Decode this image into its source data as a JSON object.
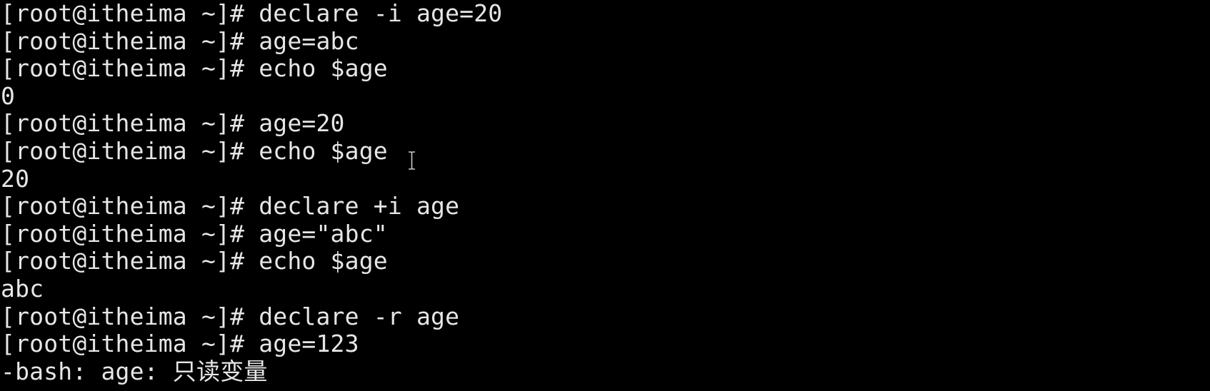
{
  "terminal": {
    "lines": [
      "[root@itheima ~]# declare -i age=20",
      "[root@itheima ~]# age=abc",
      "[root@itheima ~]# echo $age",
      "0",
      "[root@itheima ~]# age=20",
      "[root@itheima ~]# echo $age",
      "20",
      "[root@itheima ~]# declare +i age",
      "[root@itheima ~]# age=\"abc\"",
      "[root@itheima ~]# echo $age",
      "abc",
      "[root@itheima ~]# declare -r age",
      "[root@itheima ~]# age=123",
      "-bash: age: 只读变量"
    ]
  },
  "colors": {
    "background": "#000000",
    "foreground": "#e6e6e6"
  },
  "icons": {
    "mouse_pointer": "text-ibeam-cursor-icon",
    "terminal_cursor": "block-underline-cursor"
  }
}
